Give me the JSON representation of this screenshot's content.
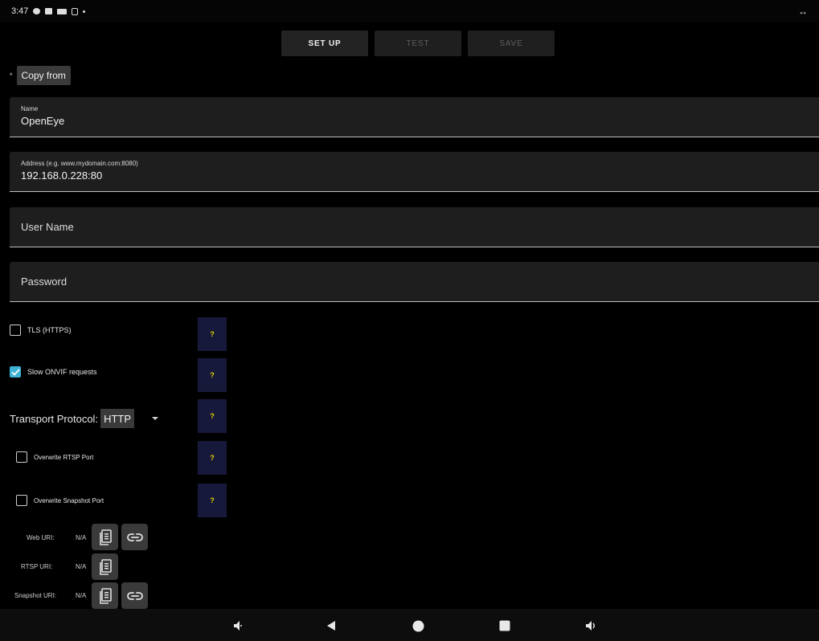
{
  "status_bar": {
    "time": "3:47",
    "right_indicator": "↔"
  },
  "actions": {
    "setup": "SET UP",
    "test": "TEST",
    "save": "SAVE"
  },
  "copy_from": {
    "marker": "*",
    "label": "Copy from"
  },
  "fields": {
    "name": {
      "label": "Name",
      "value": "OpenEye"
    },
    "address": {
      "label": "Address (e.g. www.mydomain.com:8080)",
      "value": "192.168.0.228:80"
    },
    "username": {
      "placeholder": "User Name"
    },
    "password": {
      "placeholder": "Password"
    }
  },
  "options": {
    "tls": {
      "label": "TLS (HTTPS)",
      "checked": false
    },
    "slow_onvif": {
      "label": "Slow ONVIF requests",
      "checked": true
    },
    "transport": {
      "label": "Transport Protocol:",
      "value": "HTTP"
    },
    "overwrite_rtsp": {
      "label": "Overwrite RTSP Port",
      "checked": false
    },
    "overwrite_snapshot": {
      "label": "Overwrite Snapshot Port",
      "checked": false
    },
    "help_label": "?"
  },
  "uris": {
    "web": {
      "label": "Web URI:",
      "value": "N/A"
    },
    "rtsp": {
      "label": "RTSP URI:",
      "value": "N/A"
    },
    "snapshot": {
      "label": "Snapshot URI:",
      "value": "N/A"
    }
  },
  "colors": {
    "accent": "#3db3d6",
    "help_bg": "#17193a",
    "help_text": "#e3d200"
  },
  "icons": {
    "status": [
      "settings-icon",
      "notification-icon",
      "keyboard-icon",
      "sim-icon"
    ],
    "nav": [
      "volume-down-icon",
      "back-icon",
      "home-icon",
      "recents-icon",
      "volume-up-icon"
    ],
    "uri_actions": [
      "copy-icon",
      "link-icon"
    ]
  }
}
